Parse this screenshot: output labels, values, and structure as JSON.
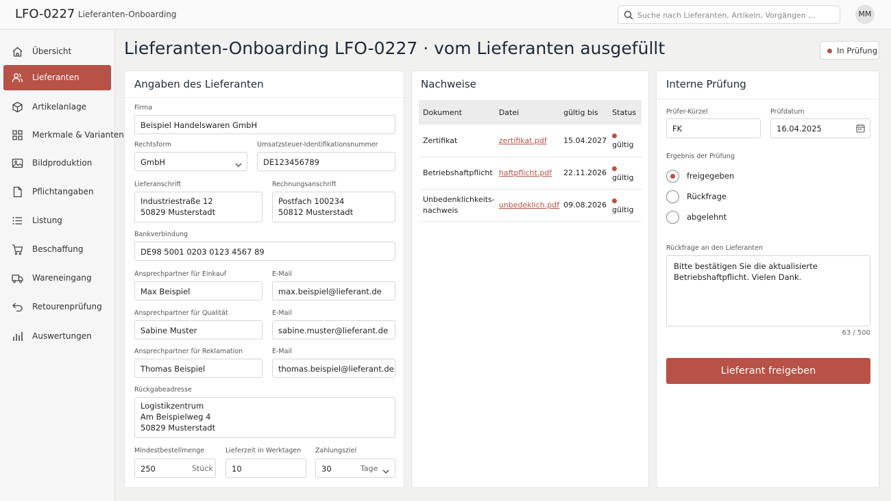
{
  "app": {
    "id": "LFO-0227",
    "breadcrumb": "Lieferanten-Onboarding"
  },
  "search": {
    "placeholder": "Suche nach Lieferanten, Artikeln, Vorgängen ..."
  },
  "user": {
    "initials": "MM"
  },
  "sidebar": {
    "items": [
      {
        "label": "Übersicht",
        "icon": "home-icon"
      },
      {
        "label": "Lieferanten",
        "icon": "users-icon",
        "active": true
      },
      {
        "label": "Artikelanlage",
        "icon": "box-icon"
      },
      {
        "label": "Merkmale & Varianten",
        "icon": "grid-icon"
      },
      {
        "label": "Bildproduktion",
        "icon": "image-icon"
      },
      {
        "label": "Pflichtangaben",
        "icon": "document-icon"
      },
      {
        "label": "Listung",
        "icon": "list-icon"
      },
      {
        "label": "Beschaffung",
        "icon": "cart-icon"
      },
      {
        "label": "Wareneingang",
        "icon": "truck-icon"
      },
      {
        "label": "Retourenprüfung",
        "icon": "return-icon"
      },
      {
        "label": "Auswertungen",
        "icon": "bar-chart-icon"
      }
    ]
  },
  "page": {
    "title": "Lieferanten-Onboarding LFO-0227 · vom Lieferanten ausgefüllt",
    "status": "In Prüfung",
    "status_color": "#b85146"
  },
  "supplier": {
    "title": "Angaben des Lieferanten",
    "firma_label": "Firma",
    "firma": "Beispiel Handelswaren GmbH",
    "rechtsform_label": "Rechtsform",
    "rechtsform": "GmbH",
    "ustid_label": "Umsatzsteuer-Identifikationsnummer",
    "ustid": "DE123456789",
    "lieferanschrift_label": "Lieferanschrift",
    "lieferanschrift": [
      "Industriestraße 12",
      "50829 Musterstadt"
    ],
    "rechnungsanschrift_label": "Rechnungsanschrift",
    "rechnungsanschrift": [
      "Postfach 100234",
      "50812 Musterstadt"
    ],
    "bank_label": "Bankverbindung",
    "bank": "DE98 5001 0203 0123 4567 89",
    "contacts": [
      {
        "role_label": "Ansprechpartner für Einkauf",
        "name": "Max Beispiel",
        "email_label": "E-Mail",
        "email": "max.beispiel@lieferant.de"
      },
      {
        "role_label": "Ansprechpartner für Qualität",
        "name": "Sabine Muster",
        "email_label": "E-Mail",
        "email": "sabine.muster@lieferant.de"
      },
      {
        "role_label": "Ansprechpartner für Reklamation",
        "name": "Thomas Beispiel",
        "email_label": "E-Mail",
        "email": "thomas.beispiel@lieferant.de"
      }
    ],
    "rueckgabe_label": "Rückgabeadresse",
    "rueckgabe": [
      "Logistikzentrum",
      "Am Beispielweg 4",
      "50829 Musterstadt"
    ],
    "mbm_label": "Mindestbestellmenge",
    "mbm": "250",
    "mbm_unit": "Stück",
    "lieferzeit_label": "Lieferzeit in Werktagen",
    "lieferzeit": "10",
    "zahlungsziel_label": "Zahlungsziel",
    "zahlungsziel": "30",
    "zahlungsziel_unit": "Tage"
  },
  "documents": {
    "title": "Nachweise",
    "headers": [
      "Dokument",
      "Datei",
      "gültig bis",
      "Status"
    ],
    "rows": [
      {
        "doc": [
          "Zertifikat"
        ],
        "file": "zertifikat.pdf",
        "valid": "15.04.2027",
        "status": "gültig"
      },
      {
        "doc": [
          "Betriebshaftpflicht"
        ],
        "file": "haftpflicht.pdf",
        "valid": "22.11.2026",
        "status": "gültig"
      },
      {
        "doc": [
          "Unbedenklichkeits-",
          "nachweis"
        ],
        "file": "unbedeklich.pdf",
        "valid": "09.08.2026",
        "status": "gültig"
      }
    ]
  },
  "review": {
    "title": "Interne Prüfung",
    "pruefer_label": "Prüfer-Kürzel",
    "pruefer": "FK",
    "datum_label": "Prüfdatum",
    "datum": "16.04.2025",
    "result_label": "Ergebnis der Prüfung",
    "options": [
      "freigegeben",
      "Rückfrage",
      "abgelehnt"
    ],
    "selected": 0,
    "rueckfrage_label": "Rückfrage an den Lieferanten",
    "rueckfrage": [
      "Bitte bestätigen Sie die aktualisierte",
      "Betriebshaftpflicht. Vielen Dank."
    ],
    "counter": "63 / 500",
    "submit_label": "Lieferant freigeben"
  }
}
